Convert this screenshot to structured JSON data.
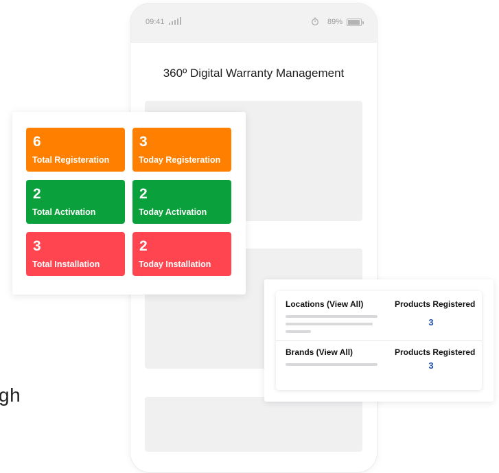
{
  "background_text": "gh",
  "phone": {
    "status_bar": {
      "time": "09:41",
      "battery_percent": "89%",
      "signal_icon": "signal-bars-icon",
      "timer_icon": "stopwatch-icon",
      "battery_icon": "battery-icon"
    },
    "title": "360º Digital Warranty Management"
  },
  "stats": {
    "tiles": [
      {
        "value": "6",
        "label": "Total Registeration",
        "color": "#ff8000"
      },
      {
        "value": "3",
        "label": "Today Registeration",
        "color": "#ff8000"
      },
      {
        "value": "2",
        "label": "Total Activation",
        "color": "#0aa03c"
      },
      {
        "value": "2",
        "label": "Today Activation",
        "color": "#0aa03c"
      },
      {
        "value": "3",
        "label": "Total Installation",
        "color": "#ff4550"
      },
      {
        "value": "2",
        "label": "Today Installation",
        "color": "#ff4550"
      }
    ]
  },
  "locations_panel": {
    "rows": [
      {
        "name_label": "Locations (View All)",
        "metric_label": "Products Registered",
        "value": "3"
      },
      {
        "name_label": "Brands (View All)",
        "metric_label": "Products Registered",
        "value": "3"
      }
    ],
    "value_color": "#1f4fb0"
  }
}
